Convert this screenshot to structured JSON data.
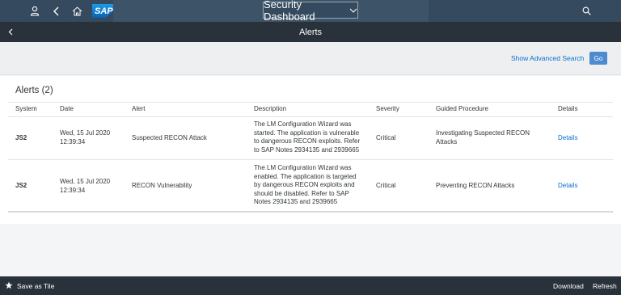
{
  "shell": {
    "logo": "SAP",
    "title": "Security Dashboard",
    "icons": [
      "user-icon",
      "back-icon",
      "home-icon",
      "search-icon"
    ]
  },
  "subheader": {
    "title": "Alerts"
  },
  "filterbar": {
    "advanced_search": "Show Advanced Search",
    "go": "Go"
  },
  "table": {
    "title": "Alerts (2)",
    "columns": [
      "System",
      "Date",
      "Alert",
      "Description",
      "Severity",
      "Guided Procedure",
      "Details"
    ],
    "rows": [
      {
        "system": "JS2",
        "date_line1": "Wed, 15 Jul 2020",
        "date_line2": "12:39:34",
        "alert": "Suspected RECON Attack",
        "description": [
          "The LM Configuration Wizard was",
          "started. The application is vulnerable",
          "to dangerous RECON exploits. Refer",
          "to SAP Notes 2934135 and 2939665"
        ],
        "severity": "Critical",
        "procedure": [
          "Investigating Suspected RECON",
          "Attacks"
        ],
        "details": "Details"
      },
      {
        "system": "JS2",
        "date_line1": "Wed, 15 Jul 2020",
        "date_line2": "12:39:34",
        "alert": "RECON Vulnerability",
        "description": [
          "The LM Configuration Wizard was",
          "enabled. The application is targeted",
          "by dangerous RECON exploits and",
          "should be disabled. Refer to SAP",
          "Notes 2934135 and 2939665"
        ],
        "severity": "Critical",
        "procedure": [
          "Preventing RECON Attacks"
        ],
        "details": "Details"
      }
    ]
  },
  "footer": {
    "save_tile": "Save as Tile",
    "download": "Download",
    "refresh": "Refresh"
  }
}
